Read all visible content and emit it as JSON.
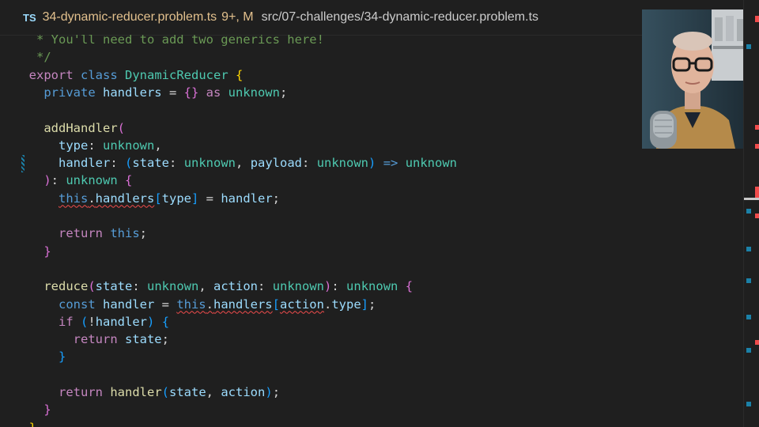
{
  "tab": {
    "language_badge": "TS",
    "filename": "34-dynamic-reducer.problem.ts",
    "status": "9+, M",
    "path": "src/07-challenges/34-dynamic-reducer.problem.ts"
  },
  "code": {
    "lines": [
      [
        {
          "t": "   * You'll need to add two generics here!",
          "c": "comment"
        }
      ],
      [
        {
          "t": "   */",
          "c": "comment"
        }
      ],
      [
        {
          "t": "  export ",
          "c": "control"
        },
        {
          "t": "class ",
          "c": "keyword"
        },
        {
          "t": "DynamicReducer ",
          "c": "type"
        },
        {
          "t": "{",
          "c": "br1"
        }
      ],
      [
        {
          "t": "    private ",
          "c": "keyword"
        },
        {
          "t": "handlers",
          "c": "var"
        },
        {
          "t": " = ",
          "c": "punct"
        },
        {
          "t": "{}",
          "c": "br2"
        },
        {
          "t": " as ",
          "c": "control"
        },
        {
          "t": "unknown",
          "c": "type"
        },
        {
          "t": ";",
          "c": "punct"
        }
      ],
      [],
      [
        {
          "t": "    addHandler",
          "c": "fn"
        },
        {
          "t": "(",
          "c": "br2"
        }
      ],
      [
        {
          "t": "      type",
          "c": "var"
        },
        {
          "t": ": ",
          "c": "punct"
        },
        {
          "t": "unknown",
          "c": "type"
        },
        {
          "t": ",",
          "c": "punct"
        }
      ],
      [
        {
          "t": "      handler",
          "c": "var"
        },
        {
          "t": ": ",
          "c": "punct"
        },
        {
          "t": "(",
          "c": "br3"
        },
        {
          "t": "state",
          "c": "var"
        },
        {
          "t": ": ",
          "c": "punct"
        },
        {
          "t": "unknown",
          "c": "type"
        },
        {
          "t": ", ",
          "c": "punct"
        },
        {
          "t": "payload",
          "c": "var"
        },
        {
          "t": ": ",
          "c": "punct"
        },
        {
          "t": "unknown",
          "c": "type"
        },
        {
          "t": ")",
          "c": "br3"
        },
        {
          "t": " => ",
          "c": "keyword"
        },
        {
          "t": "unknown",
          "c": "type"
        }
      ],
      [
        {
          "t": "    ",
          "c": "punct"
        },
        {
          "t": ")",
          "c": "br2"
        },
        {
          "t": ": ",
          "c": "punct"
        },
        {
          "t": "unknown ",
          "c": "type"
        },
        {
          "t": "{",
          "c": "br2"
        }
      ],
      [
        {
          "t": "      ",
          "c": "punct"
        },
        {
          "t": "this",
          "c": "keyword",
          "sq": true
        },
        {
          "t": ".",
          "c": "punct",
          "sq": true
        },
        {
          "t": "handlers",
          "c": "var",
          "sq": true
        },
        {
          "t": "[",
          "c": "br3"
        },
        {
          "t": "type",
          "c": "var"
        },
        {
          "t": "]",
          "c": "br3"
        },
        {
          "t": " = ",
          "c": "punct"
        },
        {
          "t": "handler",
          "c": "var"
        },
        {
          "t": ";",
          "c": "punct"
        }
      ],
      [],
      [
        {
          "t": "      return ",
          "c": "control"
        },
        {
          "t": "this",
          "c": "keyword"
        },
        {
          "t": ";",
          "c": "punct"
        }
      ],
      [
        {
          "t": "    ",
          "c": "punct"
        },
        {
          "t": "}",
          "c": "br2"
        }
      ],
      [],
      [
        {
          "t": "    reduce",
          "c": "fn"
        },
        {
          "t": "(",
          "c": "br2"
        },
        {
          "t": "state",
          "c": "var"
        },
        {
          "t": ": ",
          "c": "punct"
        },
        {
          "t": "unknown",
          "c": "type"
        },
        {
          "t": ", ",
          "c": "punct"
        },
        {
          "t": "action",
          "c": "var"
        },
        {
          "t": ": ",
          "c": "punct"
        },
        {
          "t": "unknown",
          "c": "type"
        },
        {
          "t": ")",
          "c": "br2"
        },
        {
          "t": ": ",
          "c": "punct"
        },
        {
          "t": "unknown ",
          "c": "type"
        },
        {
          "t": "{",
          "c": "br2"
        }
      ],
      [
        {
          "t": "      const ",
          "c": "keyword"
        },
        {
          "t": "handler",
          "c": "var"
        },
        {
          "t": " = ",
          "c": "punct"
        },
        {
          "t": "this",
          "c": "keyword",
          "sq": true
        },
        {
          "t": ".",
          "c": "punct",
          "sq": true
        },
        {
          "t": "handlers",
          "c": "var",
          "sq": true
        },
        {
          "t": "[",
          "c": "br3"
        },
        {
          "t": "action",
          "c": "var",
          "sq": true
        },
        {
          "t": ".",
          "c": "punct"
        },
        {
          "t": "type",
          "c": "var"
        },
        {
          "t": "]",
          "c": "br3"
        },
        {
          "t": ";",
          "c": "punct"
        }
      ],
      [
        {
          "t": "      if ",
          "c": "control"
        },
        {
          "t": "(",
          "c": "br3"
        },
        {
          "t": "!",
          "c": "punct"
        },
        {
          "t": "handler",
          "c": "var"
        },
        {
          "t": ")",
          "c": "br3"
        },
        {
          "t": " ",
          "c": "punct"
        },
        {
          "t": "{",
          "c": "br3"
        }
      ],
      [
        {
          "t": "        return ",
          "c": "control"
        },
        {
          "t": "state",
          "c": "var"
        },
        {
          "t": ";",
          "c": "punct"
        }
      ],
      [
        {
          "t": "      ",
          "c": "punct"
        },
        {
          "t": "}",
          "c": "br3"
        }
      ],
      [],
      [
        {
          "t": "      return ",
          "c": "control"
        },
        {
          "t": "handler",
          "c": "fn"
        },
        {
          "t": "(",
          "c": "br3"
        },
        {
          "t": "state",
          "c": "var"
        },
        {
          "t": ", ",
          "c": "punct"
        },
        {
          "t": "action",
          "c": "var"
        },
        {
          "t": ")",
          "c": "br3"
        },
        {
          "t": ";",
          "c": "punct"
        }
      ],
      [
        {
          "t": "    ",
          "c": "punct"
        },
        {
          "t": "}",
          "c": "br2"
        }
      ],
      [
        {
          "t": "  ",
          "c": "punct"
        },
        {
          "t": "}",
          "c": "br1"
        }
      ]
    ]
  },
  "colors": {
    "background": "#1f1f1f",
    "modified_file": "#e2c08d",
    "error_squiggle": "#f14c4c",
    "overview_error": "#f14c4c",
    "overview_info": "#1b81a8"
  },
  "icons": {
    "gutter_modified": "modified-lines-indicator",
    "webcam": "presenter-webcam-overlay"
  }
}
